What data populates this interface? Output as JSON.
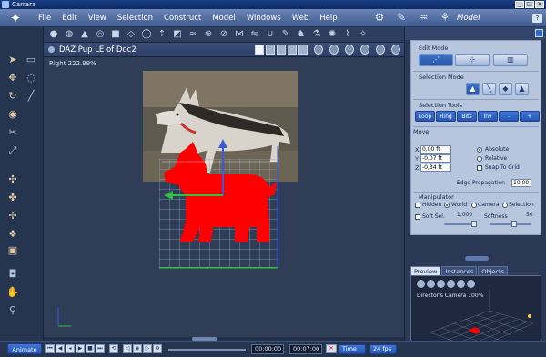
{
  "window": {
    "title": "Carrara",
    "controls": [
      "_",
      "□",
      "×"
    ]
  },
  "menu": {
    "items": [
      "File",
      "Edit",
      "View",
      "Selection",
      "Construct",
      "Model",
      "Windows",
      "Web",
      "Help"
    ],
    "room": "Model"
  },
  "document": {
    "title": "DAZ Pup LE of Doc2",
    "zoom": "Right 222.99%"
  },
  "properties": {
    "edit_mode_label": "Edit Mode",
    "selection_mode_label": "Selection Mode",
    "selection_tools_label": "Selection Tools",
    "selection_tools": [
      "Loop",
      "Ring",
      "Bits",
      "Inv",
      "-",
      "+"
    ],
    "move_label": "Move",
    "x_label": "X",
    "y_label": "Y",
    "z_label": "Z",
    "x_value": "0,00 ft",
    "y_value": "-0,07 ft",
    "z_value": "-0,34 ft",
    "absolute_label": "Absolute",
    "relative_label": "Relative",
    "snap_label": "Snap To Grid",
    "edge_propagation_label": "Edge Propagation",
    "edge_propagation_value": "10,00",
    "manipulator_label": "Manipulator",
    "hidden_label": "Hidden",
    "world_label": "World",
    "camera_label": "Camera",
    "selection_label": "Selection",
    "soft_sel_label": "Soft Sel.",
    "soft_sel_value": "1,000",
    "softness_label": "Softness",
    "softness_value": "50"
  },
  "bottom_tabs": [
    "Preview",
    "Instances",
    "Objects"
  ],
  "preview": {
    "camera_label": "Director's Camera 100%"
  },
  "timeline": {
    "animate_label": "Animate",
    "current_time": "00:00:00",
    "end_time": "00:07:00",
    "time_mode": "Time",
    "fps": "24 fps"
  },
  "colors": {
    "accent": "#2556b5",
    "selection_red": "#ff0000",
    "panel": "#b7c6dd"
  }
}
